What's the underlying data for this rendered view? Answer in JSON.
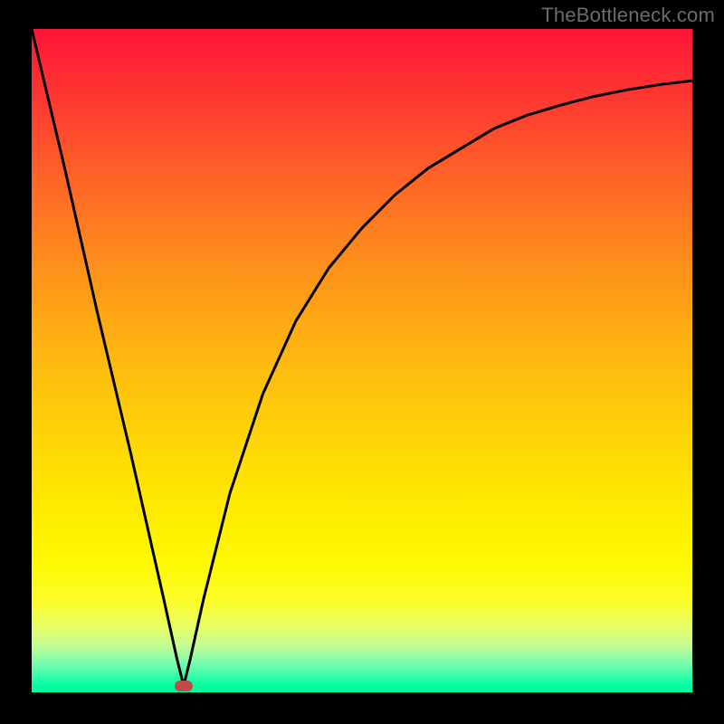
{
  "watermark": "TheBottleneck.com",
  "colors": {
    "page_bg": "#000000",
    "gradient_top": "#fe1438",
    "gradient_bottom": "#00fea1",
    "curve": "#000000",
    "marker": "#c14b49",
    "watermark_text": "#6b6b6b"
  },
  "chart_data": {
    "type": "line",
    "title": "",
    "xlabel": "",
    "ylabel": "",
    "xlim": [
      0,
      100
    ],
    "ylim": [
      0,
      100
    ],
    "marker": {
      "x": 23,
      "y": 1
    },
    "series": [
      {
        "name": "curve",
        "x": [
          0,
          5,
          10,
          15,
          20,
          22,
          23,
          24,
          26,
          30,
          35,
          40,
          45,
          50,
          55,
          60,
          65,
          70,
          75,
          80,
          85,
          90,
          95,
          100
        ],
        "values": [
          100,
          79,
          57,
          36,
          14,
          5,
          1,
          5,
          14,
          30,
          45,
          56,
          64,
          70,
          75,
          79,
          82,
          85,
          87,
          88.5,
          89.8,
          90.8,
          91.6,
          92.2
        ]
      }
    ]
  }
}
